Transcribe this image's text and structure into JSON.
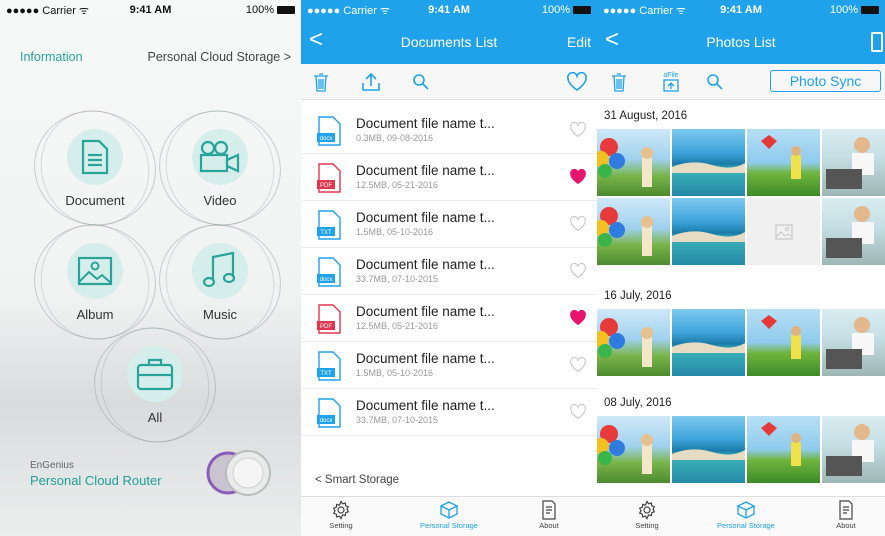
{
  "screen_home": {
    "status": {
      "carrier": "●●●●● Carrier ᯤ",
      "time": "9:41 AM",
      "battery": "100%"
    },
    "info_link": "Information",
    "storage_link": "Personal Cloud Storage >",
    "tiles": [
      {
        "label": "Document",
        "icon": "document-icon"
      },
      {
        "label": "Video",
        "icon": "video-camera-icon"
      },
      {
        "label": "Album",
        "icon": "picture-icon"
      },
      {
        "label": "Music",
        "icon": "music-note-icon"
      },
      {
        "label": "All",
        "icon": "briefcase-icon"
      }
    ],
    "brand": "EnGenius",
    "product": "Personal Cloud Router",
    "accent": "#2aa39a"
  },
  "screen_documents": {
    "status": {
      "carrier": "●●●●● Carrier ᯤ",
      "time": "9:41 AM",
      "battery": "100%"
    },
    "title": "Documents List",
    "edit": "Edit",
    "back": "<",
    "documents": [
      {
        "name": "Document file name t...",
        "meta": "0.3MB, 09-08-2016",
        "type": "docx",
        "favorite": false
      },
      {
        "name": "Document file name t...",
        "meta": "12.5MB, 05-21-2016",
        "type": "PDF",
        "favorite": true
      },
      {
        "name": "Document file name t...",
        "meta": "1.5MB, 05-10-2016",
        "type": "TXT",
        "favorite": false
      },
      {
        "name": "Document file name t...",
        "meta": "33.7MB, 07-10-2015",
        "type": "docx",
        "favorite": false
      },
      {
        "name": "Document file name t...",
        "meta": "12.5MB, 05-21-2016",
        "type": "PDF",
        "favorite": true
      },
      {
        "name": "Document file name t...",
        "meta": "1.5MB, 05-10-2016",
        "type": "TXT",
        "favorite": false
      },
      {
        "name": "Document file name t...",
        "meta": "33.7MB, 07-10-2015",
        "type": "docx",
        "favorite": false
      }
    ],
    "smart_storage": "< Smart Storage",
    "tabs": [
      {
        "label": "Setting",
        "active": false
      },
      {
        "label": "Personal Storage",
        "active": true
      },
      {
        "label": "About",
        "active": false
      }
    ],
    "brand_color": "#1fa2ea",
    "favorite_color": "#e6156e"
  },
  "screen_photos": {
    "status": {
      "carrier": "●●●●● Carrier ᯤ",
      "time": "9:41 AM",
      "battery": "100%"
    },
    "title": "Photos List",
    "back": "<",
    "afile_label": "aFile",
    "sync": "Photo Sync",
    "groups": [
      {
        "date": "31 August, 2016"
      },
      {
        "date": "16 July, 2016"
      },
      {
        "date": "08 July, 2016"
      }
    ],
    "tabs": [
      {
        "label": "Setting",
        "active": false
      },
      {
        "label": "Personal Storage",
        "active": true
      },
      {
        "label": "About",
        "active": false
      }
    ]
  }
}
